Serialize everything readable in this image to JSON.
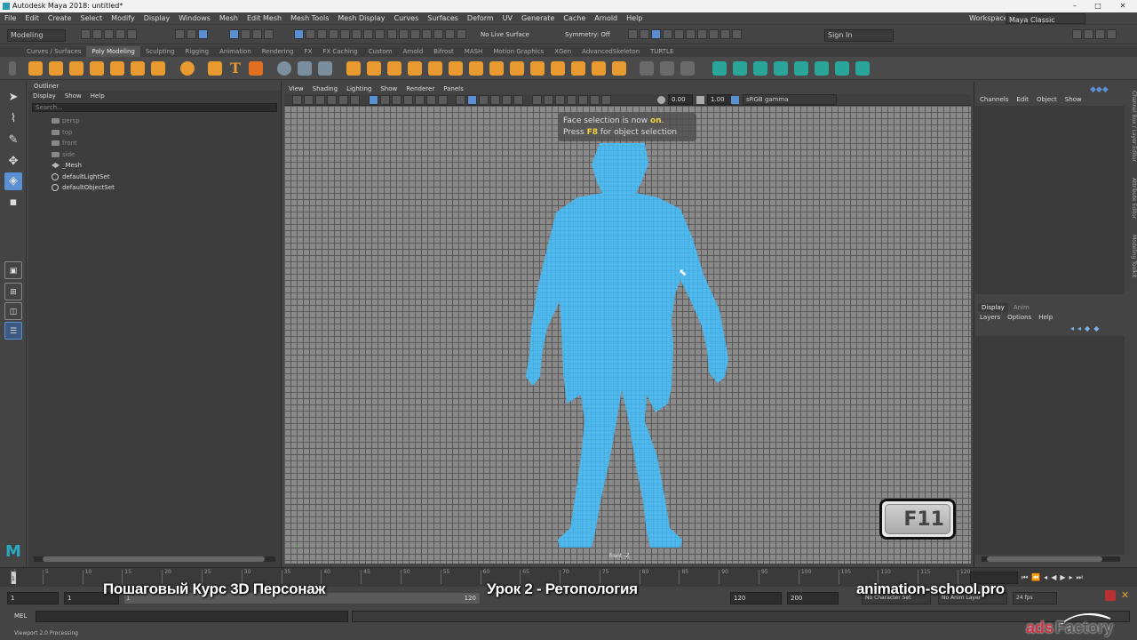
{
  "window": {
    "title": "Autodesk Maya 2018: untitled*",
    "minimize": "–",
    "maximize": "□",
    "close": "✕"
  },
  "menus": [
    "File",
    "Edit",
    "Create",
    "Select",
    "Modify",
    "Display",
    "Windows",
    "Mesh",
    "Edit Mesh",
    "Mesh Tools",
    "Mesh Display",
    "Curves",
    "Surfaces",
    "Deform",
    "UV",
    "Generate",
    "Cache",
    "Arnold",
    "Help"
  ],
  "workspace": {
    "label": "Workspace :",
    "value": "Maya Classic"
  },
  "statusline": {
    "menuset": "Modeling",
    "live_surface": "No Live Surface",
    "symmetry": "Symmetry: Off",
    "sign_in": "Sign In"
  },
  "shelf_tabs": [
    "Curves / Surfaces",
    "Poly Modeling",
    "Sculpting",
    "Rigging",
    "Animation",
    "Rendering",
    "FX",
    "FX Caching",
    "Custom",
    "Arnold",
    "Bifrost",
    "MASH",
    "Motion Graphics",
    "XGen",
    "AdvancedSkeleton",
    "TURTLE"
  ],
  "shelf_active": "Poly Modeling",
  "outliner": {
    "title": "Outliner",
    "menu": [
      "Display",
      "Show",
      "Help"
    ],
    "search_placeholder": "Search...",
    "items": [
      {
        "label": "persp",
        "dim": true,
        "type": "cam"
      },
      {
        "label": "top",
        "dim": true,
        "type": "cam"
      },
      {
        "label": "front",
        "dim": true,
        "type": "cam"
      },
      {
        "label": "side",
        "dim": true,
        "type": "cam"
      },
      {
        "label": "_Mesh",
        "dim": false,
        "type": "mesh"
      },
      {
        "label": "defaultLightSet",
        "dim": false,
        "type": "set"
      },
      {
        "label": "defaultObjectSet",
        "dim": false,
        "type": "set"
      }
    ]
  },
  "viewport": {
    "menu": [
      "View",
      "Shading",
      "Lighting",
      "Show",
      "Renderer",
      "Panels"
    ],
    "exposure": "0.00",
    "gamma": "1.00",
    "colorspace": "sRGB gamma",
    "camera_label": "front -Z",
    "hud_line1_a": "Face selection is now ",
    "hud_line1_b": "on",
    "hud_line1_c": ".",
    "hud_line2_a": "Press ",
    "hud_line2_b": "F8",
    "hud_line2_c": " for object selection",
    "key_overlay": "F11"
  },
  "channel_box": {
    "menu": [
      "Channels",
      "Edit",
      "Object",
      "Show"
    ]
  },
  "layer_editor": {
    "tabs": [
      "Display",
      "Anim"
    ],
    "menu": [
      "Layers",
      "Options",
      "Help"
    ]
  },
  "side_tabs": [
    "Channel Box / Layer Editor",
    "Attribute Editor",
    "Modeling Toolkit"
  ],
  "timeline": {
    "ticks": [
      "1",
      "5",
      "10",
      "15",
      "20",
      "25",
      "30",
      "35",
      "40",
      "45",
      "50",
      "55",
      "60",
      "65",
      "70",
      "75",
      "80",
      "85",
      "90",
      "95",
      "100",
      "105",
      "110",
      "115",
      "120"
    ],
    "current": "1"
  },
  "range": {
    "start": "1",
    "start2": "1",
    "end": "120",
    "end2": "120",
    "end3": "200",
    "character_set": "No Character Set",
    "anim_layer": "No Anim Layer",
    "fps": "24 fps"
  },
  "cmd": {
    "label": "MEL"
  },
  "helpline": "Viewport 2.0 Processing",
  "overlay": {
    "course": "Пошаговый Курс 3D Персонаж",
    "lesson": "Урок 2 - Ретопология",
    "site": "animation-school.pro"
  },
  "watermark": {
    "part1": "ads",
    "part2": "Factory"
  }
}
